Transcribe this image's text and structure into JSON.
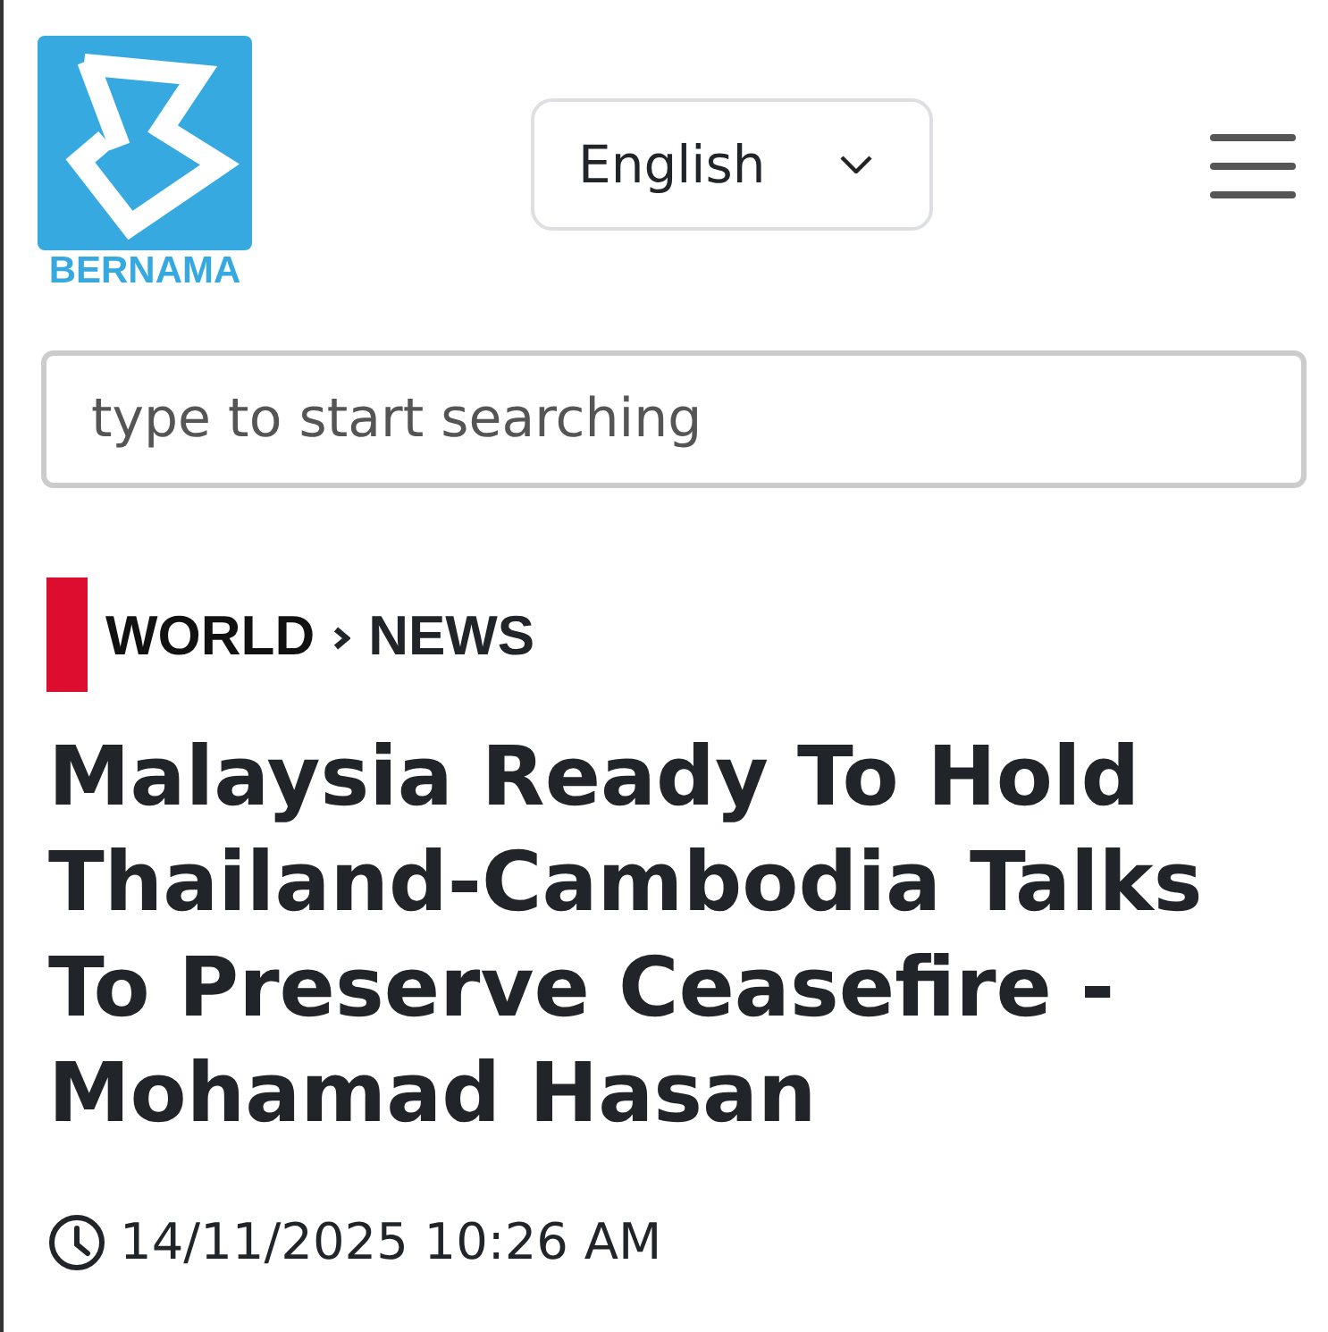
{
  "header": {
    "logo": {
      "wordmark": "BERNAMA"
    },
    "language_select": {
      "value": "English"
    }
  },
  "search": {
    "placeholder": "type to start searching"
  },
  "breadcrumb": [
    {
      "label": "WORLD"
    },
    {
      "label": "NEWS"
    }
  ],
  "article": {
    "title": "Malaysia Ready To Hold Thailand-Cambodia Talks To Preserve Ceasefire - Mohamad Hasan",
    "published": "14/11/2025 10:26 AM"
  }
}
